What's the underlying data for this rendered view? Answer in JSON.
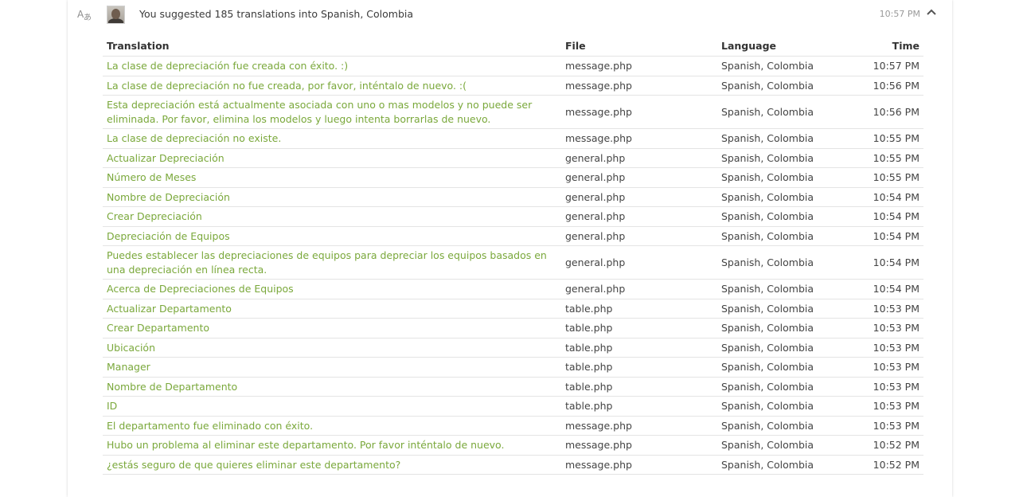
{
  "activity": {
    "icon": "translate-icon",
    "user_avatar": "user-avatar",
    "message": "You suggested 185 translations into Spanish, Colombia",
    "time": "10:57 PM",
    "toggle_icon": "chevron-up-icon"
  },
  "colors": {
    "link": "#7aa83b",
    "text": "#444444",
    "border": "#e4e4e4"
  },
  "table": {
    "headers": {
      "translation": "Translation",
      "file": "File",
      "language": "Language",
      "time": "Time"
    },
    "rows": [
      {
        "translation": "La clase de depreciación fue creada con éxito. :)",
        "file": "message.php",
        "language": "Spanish, Colombia",
        "time": "10:57 PM"
      },
      {
        "translation": "La clase de depreciación no fue creada, por favor, inténtalo de nuevo. :(",
        "file": "message.php",
        "language": "Spanish, Colombia",
        "time": "10:56 PM"
      },
      {
        "translation": "Esta depreciación está actualmente asociada con uno o mas modelos y no puede ser eliminada. Por favor, elimina los modelos y luego intenta borrarlas de nuevo.",
        "file": "message.php",
        "language": "Spanish, Colombia",
        "time": "10:56 PM"
      },
      {
        "translation": "La clase de depreciación no existe.",
        "file": "message.php",
        "language": "Spanish, Colombia",
        "time": "10:55 PM"
      },
      {
        "translation": "Actualizar Depreciación",
        "file": "general.php",
        "language": "Spanish, Colombia",
        "time": "10:55 PM"
      },
      {
        "translation": "Número de Meses",
        "file": "general.php",
        "language": "Spanish, Colombia",
        "time": "10:55 PM"
      },
      {
        "translation": "Nombre de Depreciación",
        "file": "general.php",
        "language": "Spanish, Colombia",
        "time": "10:54 PM"
      },
      {
        "translation": "Crear Depreciación",
        "file": "general.php",
        "language": "Spanish, Colombia",
        "time": "10:54 PM"
      },
      {
        "translation": "Depreciación de Equipos",
        "file": "general.php",
        "language": "Spanish, Colombia",
        "time": "10:54 PM"
      },
      {
        "translation": "Puedes establecer las depreciaciones de equipos para depreciar los equipos basados en una depreciación en línea recta.",
        "file": "general.php",
        "language": "Spanish, Colombia",
        "time": "10:54 PM"
      },
      {
        "translation": "Acerca de Depreciaciones de Equipos",
        "file": "general.php",
        "language": "Spanish, Colombia",
        "time": "10:54 PM"
      },
      {
        "translation": "Actualizar Departamento",
        "file": "table.php",
        "language": "Spanish, Colombia",
        "time": "10:53 PM"
      },
      {
        "translation": "Crear Departamento",
        "file": "table.php",
        "language": "Spanish, Colombia",
        "time": "10:53 PM"
      },
      {
        "translation": "Ubicación",
        "file": "table.php",
        "language": "Spanish, Colombia",
        "time": "10:53 PM"
      },
      {
        "translation": "Manager",
        "file": "table.php",
        "language": "Spanish, Colombia",
        "time": "10:53 PM"
      },
      {
        "translation": "Nombre de Departamento",
        "file": "table.php",
        "language": "Spanish, Colombia",
        "time": "10:53 PM"
      },
      {
        "translation": "ID",
        "file": "table.php",
        "language": "Spanish, Colombia",
        "time": "10:53 PM"
      },
      {
        "translation": "El departamento fue eliminado con éxito.",
        "file": "message.php",
        "language": "Spanish, Colombia",
        "time": "10:53 PM"
      },
      {
        "translation": "Hubo un problema al eliminar este departamento. Por favor inténtalo de nuevo.",
        "file": "message.php",
        "language": "Spanish, Colombia",
        "time": "10:52 PM"
      },
      {
        "translation": "¿estás seguro de que quieres eliminar este departamento?",
        "file": "message.php",
        "language": "Spanish, Colombia",
        "time": "10:52 PM"
      }
    ]
  }
}
